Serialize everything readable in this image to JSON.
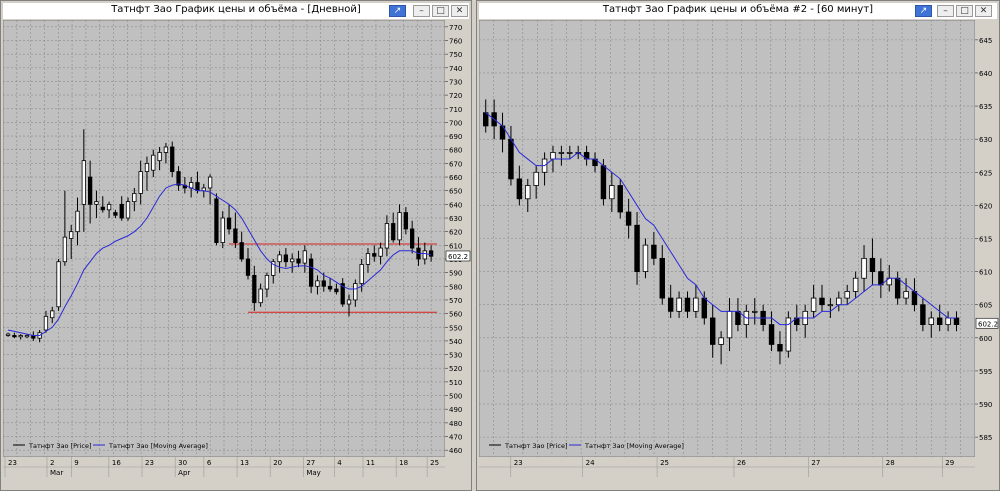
{
  "windows": [
    {
      "title": "Татнфт Зао График цены и объёма - [Дневной]",
      "buttons": {
        "pin": "pin-icon",
        "minimize": "minimize-icon",
        "maximize": "maximize-icon",
        "close": "close-icon"
      },
      "price_axis": {
        "labels": [
          "770",
          "760",
          "750",
          "740",
          "730",
          "720",
          "710",
          "700",
          "690",
          "680",
          "670",
          "660",
          "650",
          "640",
          "630",
          "620",
          "610",
          "600",
          "590",
          "580",
          "570",
          "560",
          "550",
          "540",
          "530",
          "520",
          "510",
          "500",
          "490",
          "480",
          "470",
          "460"
        ],
        "last_price": "602.2"
      },
      "legend": [
        {
          "label": "Татнфт Зао [Price]"
        },
        {
          "label": "Татнфт Зао [Moving Average]"
        }
      ],
      "time_axis": {
        "day_labels": [
          "23",
          "2",
          "9",
          "16",
          "23",
          "30",
          "6",
          "13",
          "20",
          "27",
          "4",
          "11",
          "18",
          "25"
        ],
        "month_labels": [
          "Mar",
          "Apr",
          "May"
        ]
      }
    },
    {
      "title": "Татнфт Зао График цены и объёма #2 - [60 минут]",
      "buttons": {
        "pin": "pin-icon",
        "minimize": "minimize-icon",
        "maximize": "maximize-icon",
        "close": "close-icon"
      },
      "price_axis": {
        "labels": [
          "645",
          "640",
          "635",
          "630",
          "625",
          "620",
          "615",
          "610",
          "605",
          "600",
          "595",
          "590",
          "585"
        ],
        "last_price": "602.2"
      },
      "legend": [
        {
          "label": "Татнфт Зао [Price]"
        },
        {
          "label": "Татнфт Зао [Moving Average]"
        }
      ],
      "time_axis": {
        "day_labels": [
          "23",
          "24",
          "25",
          "26",
          "27",
          "28",
          "29"
        ],
        "month_labels": []
      }
    }
  ],
  "chart_data": [
    {
      "type": "candlestick",
      "title": "Татнфт Зао График цены и объёма - [Дневной]",
      "ylim": [
        455,
        775
      ],
      "candles": [
        {
          "o": 544,
          "h": 546,
          "l": 543,
          "c": 545
        },
        {
          "o": 544,
          "h": 546,
          "l": 542,
          "c": 543
        },
        {
          "o": 543,
          "h": 545,
          "l": 541,
          "c": 544
        },
        {
          "o": 543,
          "h": 545,
          "l": 542,
          "c": 544
        },
        {
          "o": 544,
          "h": 547,
          "l": 540,
          "c": 542
        },
        {
          "o": 542,
          "h": 548,
          "l": 539,
          "c": 546
        },
        {
          "o": 548,
          "h": 562,
          "l": 546,
          "c": 558
        },
        {
          "o": 557,
          "h": 565,
          "l": 553,
          "c": 562
        },
        {
          "o": 565,
          "h": 600,
          "l": 562,
          "c": 598
        },
        {
          "o": 598,
          "h": 650,
          "l": 595,
          "c": 616
        },
        {
          "o": 615,
          "h": 625,
          "l": 600,
          "c": 620
        },
        {
          "o": 620,
          "h": 645,
          "l": 610,
          "c": 635
        },
        {
          "o": 640,
          "h": 695,
          "l": 620,
          "c": 672
        },
        {
          "o": 660,
          "h": 672,
          "l": 626,
          "c": 640
        },
        {
          "o": 640,
          "h": 650,
          "l": 630,
          "c": 642
        },
        {
          "o": 638,
          "h": 646,
          "l": 634,
          "c": 636
        },
        {
          "o": 636,
          "h": 642,
          "l": 630,
          "c": 640
        },
        {
          "o": 634,
          "h": 636,
          "l": 630,
          "c": 632
        },
        {
          "o": 640,
          "h": 646,
          "l": 628,
          "c": 630
        },
        {
          "o": 630,
          "h": 645,
          "l": 628,
          "c": 642
        },
        {
          "o": 642,
          "h": 652,
          "l": 635,
          "c": 648
        },
        {
          "o": 648,
          "h": 672,
          "l": 640,
          "c": 664
        },
        {
          "o": 664,
          "h": 675,
          "l": 650,
          "c": 670
        },
        {
          "o": 665,
          "h": 680,
          "l": 660,
          "c": 676
        },
        {
          "o": 672,
          "h": 682,
          "l": 665,
          "c": 678
        },
        {
          "o": 678,
          "h": 685,
          "l": 670,
          "c": 682
        },
        {
          "o": 682,
          "h": 686,
          "l": 660,
          "c": 664
        },
        {
          "o": 664,
          "h": 668,
          "l": 650,
          "c": 654
        },
        {
          "o": 654,
          "h": 660,
          "l": 648,
          "c": 652
        },
        {
          "o": 652,
          "h": 660,
          "l": 645,
          "c": 656
        },
        {
          "o": 656,
          "h": 664,
          "l": 648,
          "c": 650
        },
        {
          "o": 650,
          "h": 655,
          "l": 645,
          "c": 652
        },
        {
          "o": 652,
          "h": 662,
          "l": 640,
          "c": 660
        },
        {
          "o": 644,
          "h": 648,
          "l": 610,
          "c": 612
        },
        {
          "o": 612,
          "h": 635,
          "l": 608,
          "c": 630
        },
        {
          "o": 630,
          "h": 640,
          "l": 618,
          "c": 622
        },
        {
          "o": 622,
          "h": 634,
          "l": 608,
          "c": 612
        },
        {
          "o": 612,
          "h": 620,
          "l": 598,
          "c": 600
        },
        {
          "o": 600,
          "h": 608,
          "l": 585,
          "c": 588
        },
        {
          "o": 588,
          "h": 595,
          "l": 562,
          "c": 568
        },
        {
          "o": 568,
          "h": 582,
          "l": 565,
          "c": 578
        },
        {
          "o": 578,
          "h": 590,
          "l": 572,
          "c": 588
        },
        {
          "o": 588,
          "h": 600,
          "l": 582,
          "c": 598
        },
        {
          "o": 598,
          "h": 606,
          "l": 590,
          "c": 603
        },
        {
          "o": 603,
          "h": 608,
          "l": 594,
          "c": 598
        },
        {
          "o": 598,
          "h": 604,
          "l": 590,
          "c": 600
        },
        {
          "o": 600,
          "h": 606,
          "l": 594,
          "c": 597
        },
        {
          "o": 597,
          "h": 610,
          "l": 590,
          "c": 606
        },
        {
          "o": 600,
          "h": 604,
          "l": 575,
          "c": 580
        },
        {
          "o": 580,
          "h": 588,
          "l": 574,
          "c": 584
        },
        {
          "o": 584,
          "h": 590,
          "l": 576,
          "c": 580
        },
        {
          "o": 580,
          "h": 586,
          "l": 576,
          "c": 578
        },
        {
          "o": 578,
          "h": 582,
          "l": 574,
          "c": 576
        },
        {
          "o": 582,
          "h": 586,
          "l": 565,
          "c": 567
        },
        {
          "o": 567,
          "h": 574,
          "l": 558,
          "c": 570
        },
        {
          "o": 570,
          "h": 585,
          "l": 565,
          "c": 582
        },
        {
          "o": 582,
          "h": 600,
          "l": 576,
          "c": 596
        },
        {
          "o": 596,
          "h": 608,
          "l": 590,
          "c": 604
        },
        {
          "o": 604,
          "h": 610,
          "l": 598,
          "c": 602
        },
        {
          "o": 602,
          "h": 612,
          "l": 596,
          "c": 608
        },
        {
          "o": 608,
          "h": 632,
          "l": 602,
          "c": 626
        },
        {
          "o": 626,
          "h": 634,
          "l": 612,
          "c": 614
        },
        {
          "o": 614,
          "h": 640,
          "l": 610,
          "c": 634
        },
        {
          "o": 634,
          "h": 638,
          "l": 618,
          "c": 622
        },
        {
          "o": 622,
          "h": 628,
          "l": 604,
          "c": 608
        },
        {
          "o": 608,
          "h": 616,
          "l": 595,
          "c": 600
        },
        {
          "o": 600,
          "h": 612,
          "l": 596,
          "c": 606
        },
        {
          "o": 606,
          "h": 610,
          "l": 598,
          "c": 602
        }
      ],
      "moving_average": [
        548,
        547,
        546,
        545,
        544,
        544,
        547,
        550,
        556,
        565,
        573,
        582,
        592,
        598,
        604,
        608,
        610,
        613,
        615,
        617,
        620,
        624,
        630,
        638,
        646,
        652,
        654,
        655,
        654,
        652,
        650,
        650,
        649,
        646,
        643,
        640,
        636,
        630,
        622,
        614,
        606,
        600,
        596,
        594,
        593,
        594,
        595,
        595,
        594,
        592,
        588,
        586,
        583,
        580,
        578,
        578,
        580,
        584,
        588,
        592,
        598,
        603,
        606,
        606,
        606,
        604,
        604,
        603
      ],
      "support_line": 561,
      "resistance_line": 611
    },
    {
      "type": "candlestick",
      "title": "Татнфт Зао График цены и объёма #2 - [60 минут]",
      "ylim": [
        582,
        648
      ],
      "candles": [
        {
          "o": 634,
          "h": 636,
          "l": 631,
          "c": 632
        },
        {
          "o": 634,
          "h": 636,
          "l": 630,
          "c": 632
        },
        {
          "o": 632,
          "h": 634,
          "l": 628,
          "c": 630
        },
        {
          "o": 630,
          "h": 632,
          "l": 623,
          "c": 624
        },
        {
          "o": 624,
          "h": 626,
          "l": 620,
          "c": 621
        },
        {
          "o": 621,
          "h": 624,
          "l": 619,
          "c": 623
        },
        {
          "o": 623,
          "h": 626,
          "l": 621,
          "c": 625
        },
        {
          "o": 625,
          "h": 628,
          "l": 623,
          "c": 627
        },
        {
          "o": 627,
          "h": 629,
          "l": 625,
          "c": 628
        },
        {
          "o": 628,
          "h": 629,
          "l": 626,
          "c": 628
        },
        {
          "o": 628,
          "h": 629,
          "l": 627,
          "c": 628
        },
        {
          "o": 628,
          "h": 629,
          "l": 627,
          "c": 628
        },
        {
          "o": 628,
          "h": 629,
          "l": 626,
          "c": 627
        },
        {
          "o": 627,
          "h": 628,
          "l": 625,
          "c": 626
        },
        {
          "o": 626,
          "h": 627,
          "l": 620,
          "c": 621
        },
        {
          "o": 621,
          "h": 625,
          "l": 619,
          "c": 623
        },
        {
          "o": 623,
          "h": 624,
          "l": 618,
          "c": 619
        },
        {
          "o": 619,
          "h": 621,
          "l": 615,
          "c": 617
        },
        {
          "o": 617,
          "h": 619,
          "l": 608,
          "c": 610
        },
        {
          "o": 610,
          "h": 615,
          "l": 609,
          "c": 614
        },
        {
          "o": 614,
          "h": 616,
          "l": 611,
          "c": 612
        },
        {
          "o": 612,
          "h": 614,
          "l": 605,
          "c": 606
        },
        {
          "o": 606,
          "h": 608,
          "l": 603,
          "c": 604
        },
        {
          "o": 604,
          "h": 607,
          "l": 603,
          "c": 606
        },
        {
          "o": 606,
          "h": 607,
          "l": 603,
          "c": 604
        },
        {
          "o": 604,
          "h": 608,
          "l": 603,
          "c": 606
        },
        {
          "o": 606,
          "h": 607,
          "l": 602,
          "c": 603
        },
        {
          "o": 603,
          "h": 605,
          "l": 597,
          "c": 599
        },
        {
          "o": 599,
          "h": 601,
          "l": 596,
          "c": 600
        },
        {
          "o": 600,
          "h": 606,
          "l": 598,
          "c": 604
        },
        {
          "o": 604,
          "h": 606,
          "l": 601,
          "c": 602
        },
        {
          "o": 602,
          "h": 605,
          "l": 600,
          "c": 604
        },
        {
          "o": 604,
          "h": 606,
          "l": 602,
          "c": 604
        },
        {
          "o": 604,
          "h": 605,
          "l": 601,
          "c": 602
        },
        {
          "o": 602,
          "h": 604,
          "l": 598,
          "c": 599
        },
        {
          "o": 599,
          "h": 601,
          "l": 596,
          "c": 598
        },
        {
          "o": 598,
          "h": 604,
          "l": 597,
          "c": 603
        },
        {
          "o": 603,
          "h": 605,
          "l": 601,
          "c": 602
        },
        {
          "o": 602,
          "h": 605,
          "l": 600,
          "c": 604
        },
        {
          "o": 604,
          "h": 608,
          "l": 603,
          "c": 606
        },
        {
          "o": 606,
          "h": 608,
          "l": 604,
          "c": 605
        },
        {
          "o": 605,
          "h": 606,
          "l": 603,
          "c": 605
        },
        {
          "o": 605,
          "h": 607,
          "l": 604,
          "c": 606
        },
        {
          "o": 606,
          "h": 608,
          "l": 605,
          "c": 607
        },
        {
          "o": 607,
          "h": 610,
          "l": 606,
          "c": 609
        },
        {
          "o": 609,
          "h": 614,
          "l": 607,
          "c": 612
        },
        {
          "o": 612,
          "h": 615,
          "l": 608,
          "c": 610
        },
        {
          "o": 610,
          "h": 612,
          "l": 606,
          "c": 608
        },
        {
          "o": 608,
          "h": 611,
          "l": 607,
          "c": 609
        },
        {
          "o": 609,
          "h": 610,
          "l": 605,
          "c": 606
        },
        {
          "o": 606,
          "h": 609,
          "l": 605,
          "c": 607
        },
        {
          "o": 607,
          "h": 609,
          "l": 604,
          "c": 605
        },
        {
          "o": 605,
          "h": 606,
          "l": 601,
          "c": 602
        },
        {
          "o": 602,
          "h": 604,
          "l": 600,
          "c": 603
        },
        {
          "o": 603,
          "h": 605,
          "l": 601,
          "c": 602
        },
        {
          "o": 602,
          "h": 604,
          "l": 601,
          "c": 603
        },
        {
          "o": 603,
          "h": 604,
          "l": 601,
          "c": 602
        }
      ],
      "moving_average": [
        634,
        633,
        632,
        630,
        628,
        627,
        626,
        626,
        627,
        627,
        627,
        628,
        627,
        627,
        626,
        625,
        624,
        622,
        620,
        618,
        617,
        615,
        613,
        611,
        609,
        608,
        606,
        605,
        604,
        604,
        604,
        603,
        603,
        603,
        603,
        602,
        602,
        603,
        603,
        603,
        604,
        604,
        605,
        605,
        606,
        607,
        608,
        608,
        609,
        609,
        608,
        607,
        606,
        605,
        604,
        603,
        603
      ]
    }
  ]
}
